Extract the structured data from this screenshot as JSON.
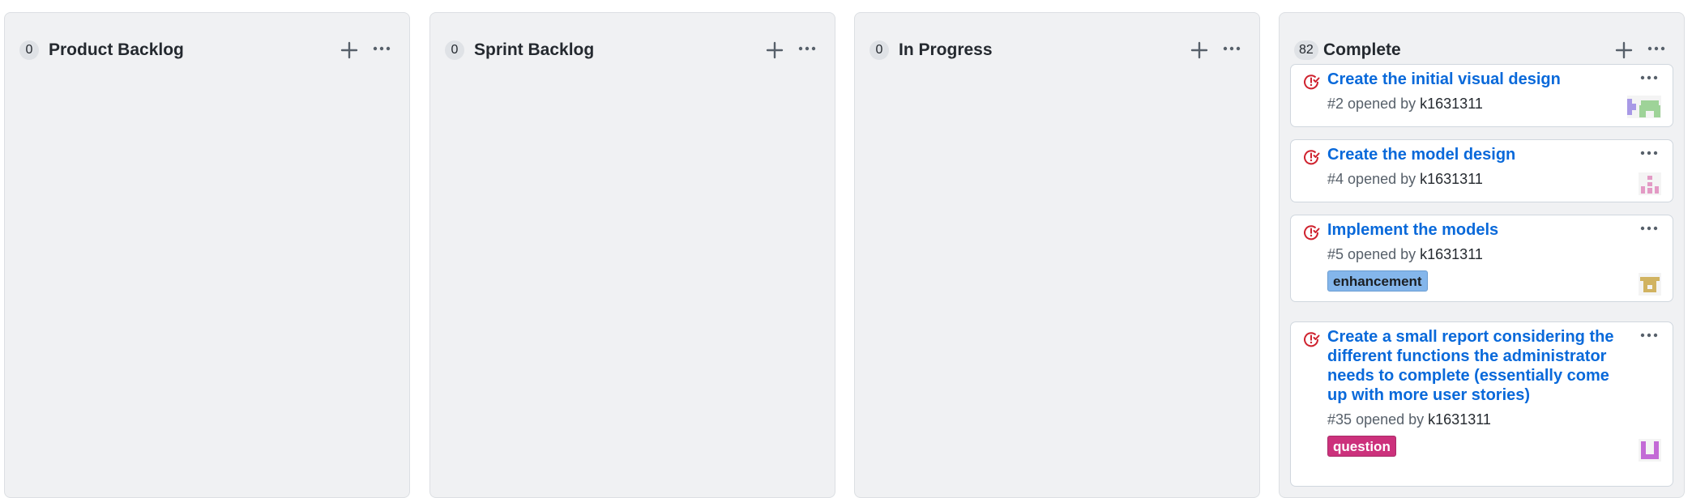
{
  "columns": [
    {
      "count": "0",
      "title": "Product Backlog"
    },
    {
      "count": "0",
      "title": "Sprint Backlog"
    },
    {
      "count": "0",
      "title": "In Progress"
    },
    {
      "count": "82",
      "title": "Complete"
    }
  ],
  "cards": [
    {
      "title": "Create the initial visual design",
      "number": "#2",
      "opened_by_text": "opened by",
      "user": "k1631311",
      "avatar_icon": "identicon-avatar",
      "avatar_colors": [
        "#a899e6",
        "#9ed398"
      ]
    },
    {
      "title": "Create the model design",
      "number": "#4",
      "opened_by_text": "opened by",
      "user": "k1631311",
      "avatar_icon": "identicon-avatar",
      "avatar_colors": [
        "#e39ac5"
      ]
    },
    {
      "title": "Implement the models",
      "number": "#5",
      "opened_by_text": "opened by",
      "user": "k1631311",
      "label": "enhancement",
      "avatar_icon": "identicon-avatar",
      "avatar_colors": [
        "#d1b361"
      ]
    },
    {
      "title": "Create a small report considering the different functions the administrator needs to complete (essentially come up with more user stories)",
      "number": "#35",
      "opened_by_text": "opened by",
      "user": "k1631311",
      "label": "question",
      "avatar_icon": "identicon-avatar",
      "avatar_colors": [
        "#c36ad6"
      ]
    }
  ],
  "icons": {
    "column_add": "plus-icon",
    "column_more": "ellipsis-icon",
    "issue_state": "issue-closed-icon",
    "card_more": "ellipsis-icon"
  },
  "colors": {
    "link": "#0969da",
    "issue_icon": "#cf222e",
    "label_enhancement": "#84b6eb",
    "label_question": "#cc317c"
  }
}
